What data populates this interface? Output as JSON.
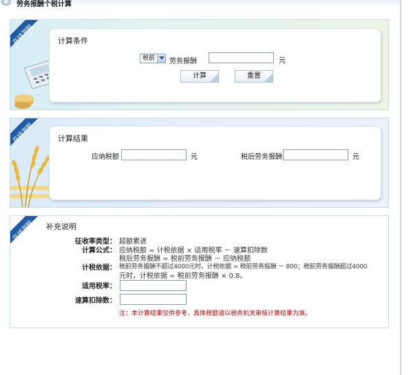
{
  "header": {
    "title": "劳务报酬个税计算"
  },
  "ribbon": {
    "label": "在线测税"
  },
  "conditions": {
    "title": "计算条件",
    "select_value": "税前",
    "field_label": "劳务报酬",
    "field_value": "",
    "unit": "元",
    "calc_button": "计算",
    "reset_button": "重置"
  },
  "results": {
    "title": "计算结果",
    "tax_label": "应纳税额",
    "tax_value": "",
    "tax_unit": "元",
    "after_label": "税后劳务报酬",
    "after_value": "",
    "after_unit": "元"
  },
  "supplement": {
    "title": "补充说明",
    "tax_type_label": "征收率类型：",
    "tax_type_value": "超额累进",
    "formula_label": "计算公式：",
    "formula_line1": "应纳税额 = 计税依据 × 适用税率 － 速算扣除数",
    "formula_line2": "税后劳务报酬 = 税前劳务报酬 － 应纳税额",
    "basis_label": "计税依据：",
    "basis_line1": "税前劳务报酬不超过4000元时，计税依据 = 税前劳务报酬 － 800；税前劳务报酬超过4000",
    "basis_line2": "元时，计税依据 = 税前劳务报酬 × 0.8。",
    "rate_label": "适用税率：",
    "rate_value": "",
    "deduction_label": "速算扣除数：",
    "deduction_value": "",
    "note": "注：本计算结果仅供参考，具体税额请以税务机关审核计算结果为准。"
  }
}
